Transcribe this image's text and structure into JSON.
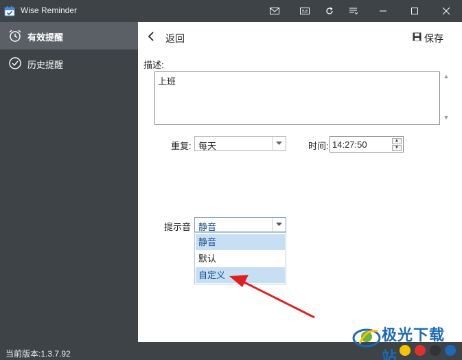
{
  "window": {
    "title": "Wise Reminder",
    "buttons": [
      "mail-icon",
      "card-icon",
      "refresh-icon",
      "menu-icon",
      "minimize-icon",
      "maximize-icon",
      "close-icon"
    ]
  },
  "sidebar": {
    "items": [
      {
        "label": "有效提醒",
        "icon": "alarm-clock-icon",
        "active": true
      },
      {
        "label": "历史提醒",
        "icon": "check-circle-icon",
        "active": false
      }
    ],
    "version": "当前版本:1.3.7.92"
  },
  "toolbar": {
    "back_label": "返回",
    "save_label": "保存"
  },
  "form": {
    "description_label": "描述:",
    "description_value": "上班",
    "repeat_label": "重复:",
    "repeat_value": "每天",
    "time_label": "时间:",
    "time_value": "14:27:50",
    "sound_label": "提示音",
    "sound_value": "静音",
    "sound_options": [
      "静音",
      "默认",
      "自定义"
    ],
    "sound_highlighted": [
      "静音",
      "自定义"
    ]
  },
  "colors": {
    "sidebar_bg": "#3d4347",
    "sidebar_active": "#5a6066",
    "annotation_arrow": "#e02020",
    "dropdown_highlight": "#c7dff2"
  },
  "watermark": {
    "text": "极光下载站"
  }
}
